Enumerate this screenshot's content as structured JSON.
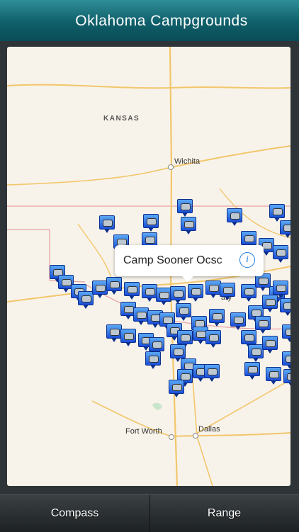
{
  "header": {
    "title": "Oklahoma Campgrounds"
  },
  "map": {
    "labels": {
      "state_kansas": "KANSAS",
      "city_wichita": "Wichita",
      "city_fort_worth": "Fort Worth",
      "city_dallas": "Dallas",
      "city_partial": "ary"
    },
    "callout": {
      "title": "Camp Sooner Ocsc",
      "info_icon": "info-icon"
    },
    "pin_icon": "campground-pin-icon",
    "colors": {
      "pin": "#1a4fd8",
      "road": "#f2c66b",
      "border": "#e7a0a0",
      "land": "#f8f3ea"
    }
  },
  "footer": {
    "tabs": [
      {
        "label": "Compass"
      },
      {
        "label": "Range"
      }
    ]
  }
}
